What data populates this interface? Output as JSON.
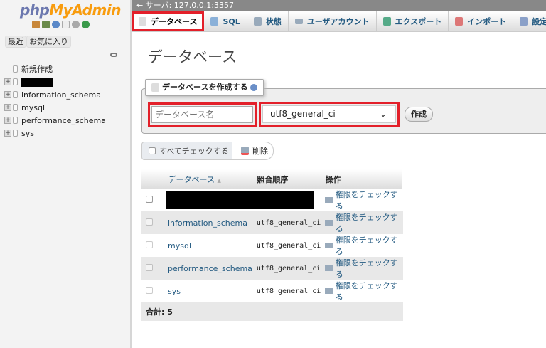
{
  "sidebar": {
    "logo": {
      "php": "php",
      "myadmin": "MyAdmin"
    },
    "recent": "最近",
    "favorites": "お気に入り",
    "new": "新規作成",
    "databases": [
      "information_schema",
      "mysql",
      "performance_schema",
      "sys"
    ]
  },
  "topbar": {
    "server": "サーバ: 127.0.0.1:3357"
  },
  "tabs": [
    "データベース",
    "SQL",
    "状態",
    "ユーザアカウント",
    "エクスポート",
    "インポート",
    "設定"
  ],
  "page_title": "データベース",
  "create": {
    "legend": "データベースを作成する",
    "name_placeholder": "データベース名",
    "collation": "utf8_general_ci",
    "button": "作成"
  },
  "actions": {
    "check_all": "すべてチェックする",
    "delete": "削除"
  },
  "table": {
    "headers": [
      "データベース",
      "照合順序",
      "操作"
    ],
    "sort_indicator": "▲",
    "rows": [
      {
        "name": "",
        "collation": "",
        "action": "権限をチェックする"
      },
      {
        "name": "information_schema",
        "collation": "utf8_general_ci",
        "action": "権限をチェックする"
      },
      {
        "name": "mysql",
        "collation": "utf8_general_ci",
        "action": "権限をチェックする"
      },
      {
        "name": "performance_schema",
        "collation": "utf8_general_ci",
        "action": "権限をチェックする"
      },
      {
        "name": "sys",
        "collation": "utf8_general_ci",
        "action": "権限をチェックする"
      }
    ],
    "total": "合計: 5"
  },
  "colors": {
    "highlight": "#e3202a",
    "link": "#235a81"
  }
}
